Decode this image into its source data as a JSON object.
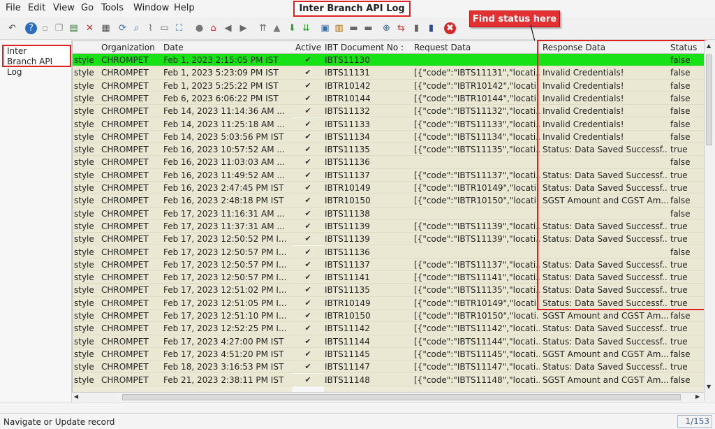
{
  "window": {
    "title": "Inter Branch API Log"
  },
  "menu": [
    "File",
    "Edit",
    "View",
    "Go",
    "Tools",
    "Window",
    "Help"
  ],
  "toolbar_icons": [
    "undo-icon",
    "help-icon",
    "new-icon",
    "copy-icon",
    "save-icon",
    "delete-icon",
    "print-icon",
    "refresh-icon",
    "find-icon",
    "attach-icon",
    "chat-icon",
    "zoom-icon",
    "history-icon",
    "home-icon",
    "prev-icon",
    "next-icon",
    "first-icon",
    "parent-icon",
    "detail-icon",
    "last-icon",
    "report-icon",
    "archive-icon",
    "print-preview-icon",
    "export-icon",
    "zoom-across-icon",
    "request-icon",
    "product-icon",
    "window-icon",
    "close-icon"
  ],
  "annotation": {
    "label": "Find status here"
  },
  "left_panel": {
    "label_line1": "Inter",
    "label_line2": "Branch API Log"
  },
  "columns": {
    "organization": "Organization",
    "date": "Date",
    "active": "Active",
    "ibt_doc": "IBT Document No :",
    "request": "Request Data",
    "response": "Response Data",
    "status": "Status"
  },
  "rows": [
    {
      "c0": "style",
      "org": "CHROMPET",
      "date": "Feb 1, 2023 2:15:05 PM IST",
      "doc": "IBTS11130",
      "req": "",
      "resp": "",
      "status": "false",
      "selected": true
    },
    {
      "c0": "style",
      "org": "CHROMPET",
      "date": "Feb 1, 2023 5:23:09 PM IST",
      "doc": "IBTS11131",
      "req": "[{\"code\":\"IBTS11131\",\"locati...",
      "resp": "Invalid Credentials!",
      "status": "false"
    },
    {
      "c0": "style",
      "org": "CHROMPET",
      "date": "Feb 1, 2023 5:25:22 PM IST",
      "doc": "IBTR10142",
      "req": "[{\"code\":\"IBTR10142\",\"locati...",
      "resp": "Invalid Credentials!",
      "status": "false"
    },
    {
      "c0": "style",
      "org": "CHROMPET",
      "date": "Feb 6, 2023 6:06:22 PM IST",
      "doc": "IBTR10144",
      "req": "[{\"code\":\"IBTR10144\",\"locati...",
      "resp": "Invalid Credentials!",
      "status": "false"
    },
    {
      "c0": "style",
      "org": "CHROMPET",
      "date": "Feb 14, 2023 11:14:36 AM ...",
      "doc": "IBTS11132",
      "req": "[{\"code\":\"IBTS11132\",\"locati...",
      "resp": "Invalid Credentials!",
      "status": "false"
    },
    {
      "c0": "style",
      "org": "CHROMPET",
      "date": "Feb 14, 2023 11:25:18 AM ...",
      "doc": "IBTS11133",
      "req": "[{\"code\":\"IBTS11133\",\"locati...",
      "resp": "Invalid Credentials!",
      "status": "false"
    },
    {
      "c0": "style",
      "org": "CHROMPET",
      "date": "Feb 14, 2023 5:03:56 PM IST",
      "doc": "IBTS11134",
      "req": "[{\"code\":\"IBTS11134\",\"locati...",
      "resp": "Invalid Credentials!",
      "status": "false"
    },
    {
      "c0": "style",
      "org": "CHROMPET",
      "date": "Feb 16, 2023 10:57:52 AM ...",
      "doc": "IBTS11135",
      "req": "[{\"code\":\"IBTS11135\",\"locati...",
      "resp": "Status: Data Saved Successf...",
      "status": "true"
    },
    {
      "c0": "style",
      "org": "CHROMPET",
      "date": "Feb 16, 2023 11:03:03 AM ...",
      "doc": "IBTS11136",
      "req": "",
      "resp": "",
      "status": "false"
    },
    {
      "c0": "style",
      "org": "CHROMPET",
      "date": "Feb 16, 2023 11:49:52 AM ...",
      "doc": "IBTS11137",
      "req": "[{\"code\":\"IBTS11137\",\"locati...",
      "resp": "Status: Data Saved Successf...",
      "status": "true"
    },
    {
      "c0": "style",
      "org": "CHROMPET",
      "date": "Feb 16, 2023 2:47:45 PM IST",
      "doc": "IBTR10149",
      "req": "[{\"code\":\"IBTR10149\",\"locati...",
      "resp": "Status: Data Saved Successf...",
      "status": "true"
    },
    {
      "c0": "style",
      "org": "CHROMPET",
      "date": "Feb 16, 2023 2:48:18 PM IST",
      "doc": "IBTR10150",
      "req": "[{\"code\":\"IBTR10150\",\"locati...",
      "resp": "SGST Amount and CGST Am...",
      "status": "false"
    },
    {
      "c0": "style",
      "org": "CHROMPET",
      "date": "Feb 17, 2023 11:16:31 AM ...",
      "doc": "IBTS11138",
      "req": "",
      "resp": "",
      "status": "false"
    },
    {
      "c0": "style",
      "org": "CHROMPET",
      "date": "Feb 17, 2023 11:37:31 AM ...",
      "doc": "IBTS11139",
      "req": "[{\"code\":\"IBTS11139\",\"locati...",
      "resp": "Status: Data Saved Successf...",
      "status": "true"
    },
    {
      "c0": "style",
      "org": "CHROMPET",
      "date": "Feb 17, 2023 12:50:52 PM I...",
      "doc": "IBTS11139",
      "req": "[{\"code\":\"IBTS11139\",\"locati...",
      "resp": "Status: Data Saved Successf...",
      "status": "true"
    },
    {
      "c0": "style",
      "org": "CHROMPET",
      "date": "Feb 17, 2023 12:50:57 PM I...",
      "doc": "IBTS11136",
      "req": "",
      "resp": "",
      "status": "false"
    },
    {
      "c0": "style",
      "org": "CHROMPET",
      "date": "Feb 17, 2023 12:50:57 PM I...",
      "doc": "IBTS11137",
      "req": "[{\"code\":\"IBTS11137\",\"locati...",
      "resp": "Status: Data Saved Successf...",
      "status": "true"
    },
    {
      "c0": "style",
      "org": "CHROMPET",
      "date": "Feb 17, 2023 12:50:57 PM I...",
      "doc": "IBTS11141",
      "req": "[{\"code\":\"IBTS11141\",\"locati...",
      "resp": "Status: Data Saved Successf...",
      "status": "true"
    },
    {
      "c0": "style",
      "org": "CHROMPET",
      "date": "Feb 17, 2023 12:51:02 PM I...",
      "doc": "IBTS11135",
      "req": "[{\"code\":\"IBTS11135\",\"locati...",
      "resp": "Status: Data Saved Successf...",
      "status": "true"
    },
    {
      "c0": "style",
      "org": "CHROMPET",
      "date": "Feb 17, 2023 12:51:05 PM I...",
      "doc": "IBTR10149",
      "req": "[{\"code\":\"IBTR10149\",\"locati...",
      "resp": "Status: Data Saved Successf...",
      "status": "true"
    },
    {
      "c0": "style",
      "org": "CHROMPET",
      "date": "Feb 17, 2023 12:51:10 PM I...",
      "doc": "IBTR10150",
      "req": "[{\"code\":\"IBTR10150\",\"locati...",
      "resp": "SGST Amount and CGST Am...",
      "status": "false"
    },
    {
      "c0": "style",
      "org": "CHROMPET",
      "date": "Feb 17, 2023 12:52:25 PM I...",
      "doc": "IBTS11142",
      "req": "[{\"code\":\"IBTS11142\",\"locati...",
      "resp": "Status: Data Saved Successf...",
      "status": "true"
    },
    {
      "c0": "style",
      "org": "CHROMPET",
      "date": "Feb 17, 2023 4:27:00 PM IST",
      "doc": "IBTS11144",
      "req": "[{\"code\":\"IBTS11144\",\"locati...",
      "resp": "Status: Data Saved Successf...",
      "status": "true"
    },
    {
      "c0": "style",
      "org": "CHROMPET",
      "date": "Feb 17, 2023 4:51:20 PM IST",
      "doc": "IBTS11145",
      "req": "[{\"code\":\"IBTS11145\",\"locati...",
      "resp": "SGST Amount and CGST Am...",
      "status": "false"
    },
    {
      "c0": "style",
      "org": "CHROMPET",
      "date": "Feb 18, 2023 3:16:53 PM IST",
      "doc": "IBTS11147",
      "req": "[{\"code\":\"IBTS11147\",\"locati...",
      "resp": "Status: Data Saved Successf...",
      "status": "true"
    },
    {
      "c0": "style",
      "org": "CHROMPET",
      "date": "Feb 21, 2023 2:38:11 PM IST",
      "doc": "IBTS11148",
      "req": "[{\"code\":\"IBTS11148\",\"locati...",
      "resp": "SGST Amount and CGST Am...",
      "status": "false"
    }
  ],
  "status_bar": {
    "message": "Navigate or Update record",
    "record_count": "1/153"
  },
  "colors": {
    "selected_row": "#16e216",
    "annotation": "#e02020",
    "grid_bg": "#eae7d2"
  }
}
